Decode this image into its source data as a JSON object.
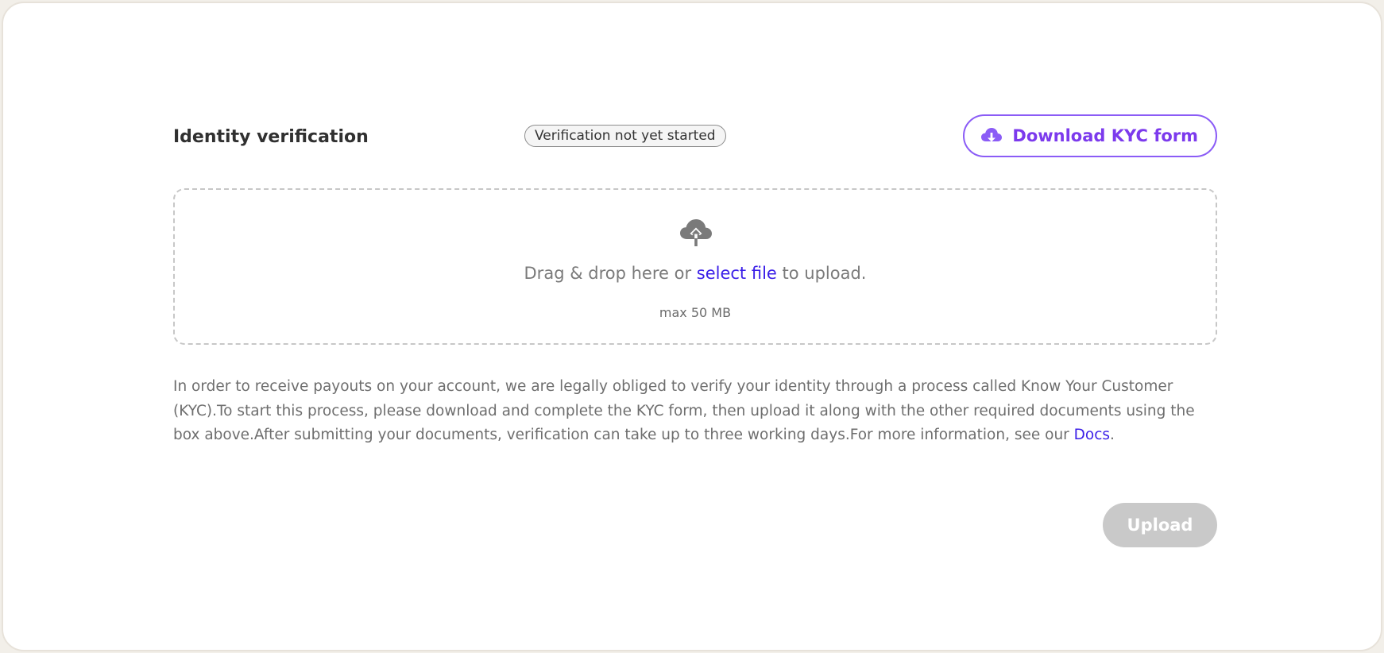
{
  "header": {
    "title": "Identity verification",
    "status": "Verification not yet started",
    "download_button": "Download KYC form"
  },
  "dropzone": {
    "prefix": "Drag & drop here or ",
    "link": "select file",
    "suffix": " to upload.",
    "max_size": "max 50 MB",
    "icon": "cloud-upload-icon"
  },
  "description": {
    "text": "In order to receive payouts on your account, we are legally obliged to verify your identity through a process called Know Your Customer (KYC).To start this process, please download and complete the KYC form, then upload it along with the other required documents using the box above.After submitting your documents, verification can take up to three working days.For more information, see our ",
    "link": "Docs",
    "end": "."
  },
  "footer": {
    "upload_button": "Upload"
  },
  "colors": {
    "accent": "#7c3aed",
    "link": "#3b1fe8",
    "disabled": "#c9c9c9"
  }
}
